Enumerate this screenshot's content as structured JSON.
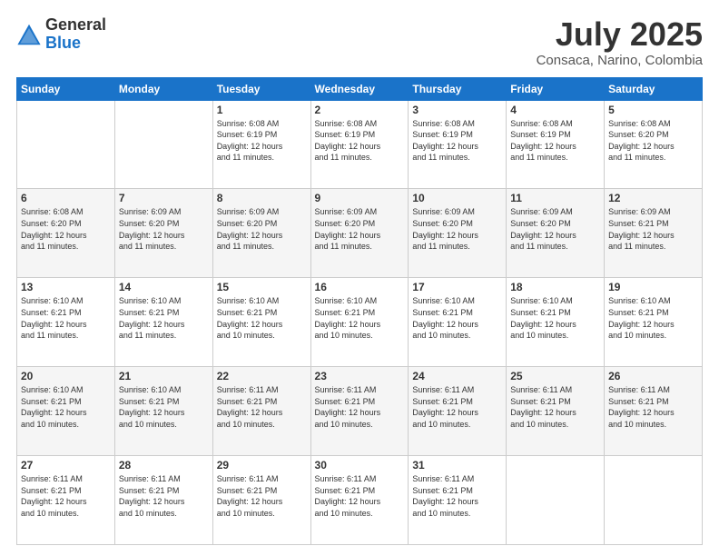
{
  "logo": {
    "general": "General",
    "blue": "Blue"
  },
  "title": "July 2025",
  "location": "Consaca, Narino, Colombia",
  "weekdays": [
    "Sunday",
    "Monday",
    "Tuesday",
    "Wednesday",
    "Thursday",
    "Friday",
    "Saturday"
  ],
  "weeks": [
    [
      {
        "day": "",
        "info": ""
      },
      {
        "day": "",
        "info": ""
      },
      {
        "day": "1",
        "info": "Sunrise: 6:08 AM\nSunset: 6:19 PM\nDaylight: 12 hours\nand 11 minutes."
      },
      {
        "day": "2",
        "info": "Sunrise: 6:08 AM\nSunset: 6:19 PM\nDaylight: 12 hours\nand 11 minutes."
      },
      {
        "day": "3",
        "info": "Sunrise: 6:08 AM\nSunset: 6:19 PM\nDaylight: 12 hours\nand 11 minutes."
      },
      {
        "day": "4",
        "info": "Sunrise: 6:08 AM\nSunset: 6:19 PM\nDaylight: 12 hours\nand 11 minutes."
      },
      {
        "day": "5",
        "info": "Sunrise: 6:08 AM\nSunset: 6:20 PM\nDaylight: 12 hours\nand 11 minutes."
      }
    ],
    [
      {
        "day": "6",
        "info": "Sunrise: 6:08 AM\nSunset: 6:20 PM\nDaylight: 12 hours\nand 11 minutes."
      },
      {
        "day": "7",
        "info": "Sunrise: 6:09 AM\nSunset: 6:20 PM\nDaylight: 12 hours\nand 11 minutes."
      },
      {
        "day": "8",
        "info": "Sunrise: 6:09 AM\nSunset: 6:20 PM\nDaylight: 12 hours\nand 11 minutes."
      },
      {
        "day": "9",
        "info": "Sunrise: 6:09 AM\nSunset: 6:20 PM\nDaylight: 12 hours\nand 11 minutes."
      },
      {
        "day": "10",
        "info": "Sunrise: 6:09 AM\nSunset: 6:20 PM\nDaylight: 12 hours\nand 11 minutes."
      },
      {
        "day": "11",
        "info": "Sunrise: 6:09 AM\nSunset: 6:20 PM\nDaylight: 12 hours\nand 11 minutes."
      },
      {
        "day": "12",
        "info": "Sunrise: 6:09 AM\nSunset: 6:21 PM\nDaylight: 12 hours\nand 11 minutes."
      }
    ],
    [
      {
        "day": "13",
        "info": "Sunrise: 6:10 AM\nSunset: 6:21 PM\nDaylight: 12 hours\nand 11 minutes."
      },
      {
        "day": "14",
        "info": "Sunrise: 6:10 AM\nSunset: 6:21 PM\nDaylight: 12 hours\nand 11 minutes."
      },
      {
        "day": "15",
        "info": "Sunrise: 6:10 AM\nSunset: 6:21 PM\nDaylight: 12 hours\nand 10 minutes."
      },
      {
        "day": "16",
        "info": "Sunrise: 6:10 AM\nSunset: 6:21 PM\nDaylight: 12 hours\nand 10 minutes."
      },
      {
        "day": "17",
        "info": "Sunrise: 6:10 AM\nSunset: 6:21 PM\nDaylight: 12 hours\nand 10 minutes."
      },
      {
        "day": "18",
        "info": "Sunrise: 6:10 AM\nSunset: 6:21 PM\nDaylight: 12 hours\nand 10 minutes."
      },
      {
        "day": "19",
        "info": "Sunrise: 6:10 AM\nSunset: 6:21 PM\nDaylight: 12 hours\nand 10 minutes."
      }
    ],
    [
      {
        "day": "20",
        "info": "Sunrise: 6:10 AM\nSunset: 6:21 PM\nDaylight: 12 hours\nand 10 minutes."
      },
      {
        "day": "21",
        "info": "Sunrise: 6:10 AM\nSunset: 6:21 PM\nDaylight: 12 hours\nand 10 minutes."
      },
      {
        "day": "22",
        "info": "Sunrise: 6:11 AM\nSunset: 6:21 PM\nDaylight: 12 hours\nand 10 minutes."
      },
      {
        "day": "23",
        "info": "Sunrise: 6:11 AM\nSunset: 6:21 PM\nDaylight: 12 hours\nand 10 minutes."
      },
      {
        "day": "24",
        "info": "Sunrise: 6:11 AM\nSunset: 6:21 PM\nDaylight: 12 hours\nand 10 minutes."
      },
      {
        "day": "25",
        "info": "Sunrise: 6:11 AM\nSunset: 6:21 PM\nDaylight: 12 hours\nand 10 minutes."
      },
      {
        "day": "26",
        "info": "Sunrise: 6:11 AM\nSunset: 6:21 PM\nDaylight: 12 hours\nand 10 minutes."
      }
    ],
    [
      {
        "day": "27",
        "info": "Sunrise: 6:11 AM\nSunset: 6:21 PM\nDaylight: 12 hours\nand 10 minutes."
      },
      {
        "day": "28",
        "info": "Sunrise: 6:11 AM\nSunset: 6:21 PM\nDaylight: 12 hours\nand 10 minutes."
      },
      {
        "day": "29",
        "info": "Sunrise: 6:11 AM\nSunset: 6:21 PM\nDaylight: 12 hours\nand 10 minutes."
      },
      {
        "day": "30",
        "info": "Sunrise: 6:11 AM\nSunset: 6:21 PM\nDaylight: 12 hours\nand 10 minutes."
      },
      {
        "day": "31",
        "info": "Sunrise: 6:11 AM\nSunset: 6:21 PM\nDaylight: 12 hours\nand 10 minutes."
      },
      {
        "day": "",
        "info": ""
      },
      {
        "day": "",
        "info": ""
      }
    ]
  ]
}
